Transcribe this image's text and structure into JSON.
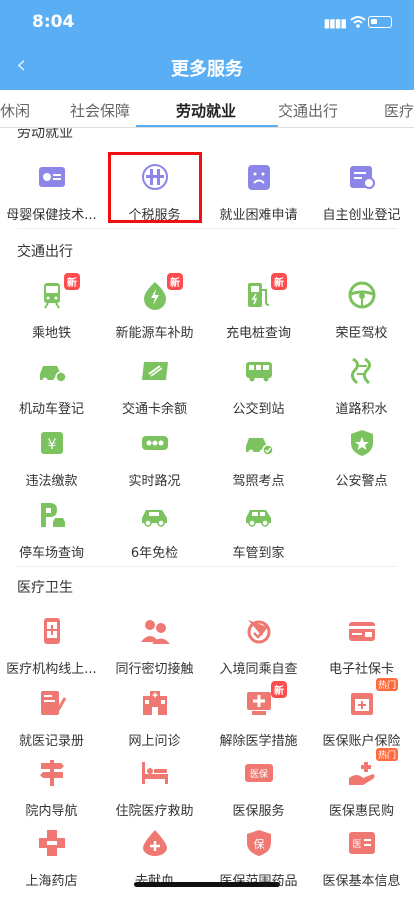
{
  "status_bar": {
    "time": "8:04",
    "signal": "▮▮▮▮"
  },
  "nav": {
    "back": "‹",
    "title": "更多服务"
  },
  "tabs": [
    {
      "label": "休闲"
    },
    {
      "label": "社会保障"
    },
    {
      "label": "劳动就业",
      "active": true
    },
    {
      "label": "交通出行"
    },
    {
      "label": "医疗"
    }
  ],
  "sections": {
    "labor": {
      "title": "劳动就业",
      "items": [
        {
          "label": "母婴保健技术...",
          "icon": "maternal-card-icon"
        },
        {
          "label": "个税服务",
          "icon": "tax-emblem-icon"
        },
        {
          "label": "就业困难申请",
          "icon": "employment-difficulty-icon"
        },
        {
          "label": "自主创业登记",
          "icon": "startup-register-icon"
        }
      ]
    },
    "traffic": {
      "title": "交通出行",
      "items": [
        {
          "label": "乘地铁",
          "icon": "subway-icon",
          "badge": "新"
        },
        {
          "label": "新能源车补助",
          "icon": "energy-bolt-icon",
          "badge": "新"
        },
        {
          "label": "充电桩查询",
          "icon": "charging-pile-icon",
          "badge": "新"
        },
        {
          "label": "荣臣驾校",
          "icon": "steering-wheel-icon"
        },
        {
          "label": "机动车登记",
          "icon": "car-register-icon"
        },
        {
          "label": "交通卡余额",
          "icon": "traffic-card-icon"
        },
        {
          "label": "公交到站",
          "icon": "bus-icon"
        },
        {
          "label": "道路积水",
          "icon": "road-water-icon"
        },
        {
          "label": "违法缴款",
          "icon": "fine-payment-icon"
        },
        {
          "label": "实时路况",
          "icon": "live-traffic-icon"
        },
        {
          "label": "驾照考点",
          "icon": "exam-car-icon"
        },
        {
          "label": "公安警点",
          "icon": "police-shield-icon"
        },
        {
          "label": "停车场查询",
          "icon": "parking-icon"
        },
        {
          "label": "6年免检",
          "icon": "car-inspect-icon"
        },
        {
          "label": "车管到家",
          "icon": "car-home-icon"
        }
      ]
    },
    "medical": {
      "title": "医疗卫生",
      "items": [
        {
          "label": "医疗机构线上...",
          "icon": "phone-medical-icon"
        },
        {
          "label": "同行密切接触",
          "icon": "contacts-icon"
        },
        {
          "label": "入境同乘自查",
          "icon": "plane-check-icon"
        },
        {
          "label": "电子社保卡",
          "icon": "social-card-icon"
        },
        {
          "label": "就医记录册",
          "icon": "medical-record-icon"
        },
        {
          "label": "网上问诊",
          "icon": "hospital-icon"
        },
        {
          "label": "解除医学措施",
          "icon": "release-measure-icon",
          "badge": "新"
        },
        {
          "label": "医保账户保险",
          "icon": "insurance-account-icon",
          "hot": "热门"
        },
        {
          "label": "院内导航",
          "icon": "signpost-icon"
        },
        {
          "label": "住院医疗救助",
          "icon": "bed-icon"
        },
        {
          "label": "医保服务",
          "icon": "medical-insurance-icon"
        },
        {
          "label": "医保惠民购",
          "icon": "hand-cross-icon",
          "hot": "热门"
        },
        {
          "label": "上海药店",
          "icon": "pharmacy-icon"
        },
        {
          "label": "去献血",
          "icon": "blood-drop-icon"
        },
        {
          "label": "医保范围药品",
          "icon": "shield-bao-icon"
        },
        {
          "label": "医保基本信息",
          "icon": "info-card-icon"
        }
      ]
    }
  },
  "colors": {
    "primary": "#5aaef3",
    "traffic_green": "#7cc35f",
    "medical_red": "#f07872",
    "labor_purple": "#8c86e8",
    "highlight": "#e11111"
  }
}
